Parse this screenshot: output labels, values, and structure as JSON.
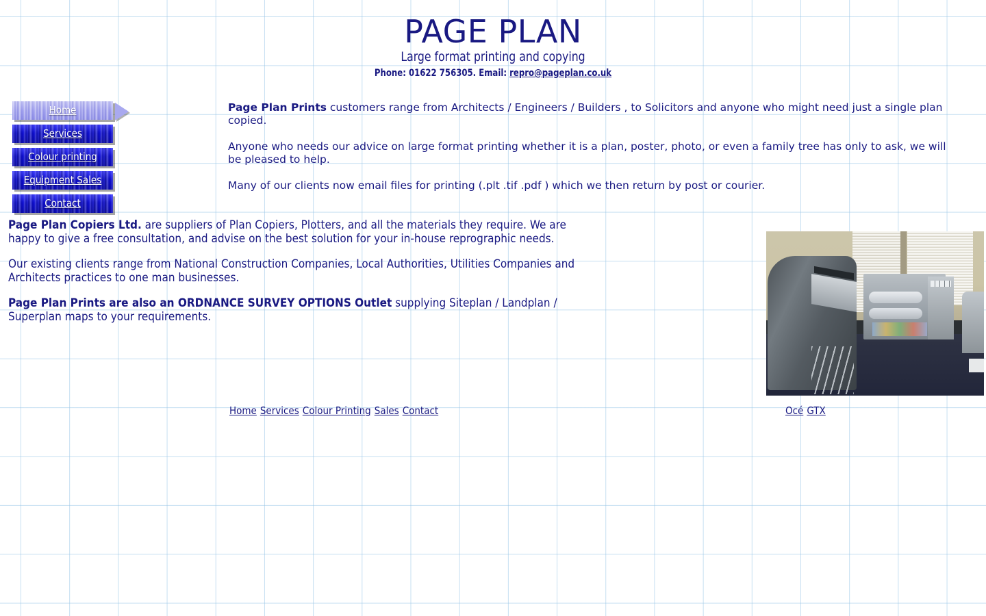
{
  "header": {
    "title": "PAGE PLAN",
    "tagline": "Large format printing and copying",
    "phone_label": "Phone: 01622 756305. Email:",
    "email": "repro@pageplan.co.uk"
  },
  "nav": {
    "items": [
      {
        "label": "Home",
        "active": true
      },
      {
        "label": "Services",
        "active": false
      },
      {
        "label": "Colour printing",
        "active": false
      },
      {
        "label": "Equipment Sales",
        "active": false
      },
      {
        "label": "Contact",
        "active": false
      }
    ]
  },
  "intro": {
    "p1_bold": "Page Plan Prints",
    "p1_rest": " customers range from Architects / Engineers / Builders , to Solicitors and anyone who might need just a single plan copied.",
    "p2": "Anyone who needs our advice on large format printing whether it is a plan, poster, photo, or even a family tree has only to ask, we will be pleased to help.",
    "p3": "Many of our clients now email files for printing (.plt .tif .pdf ) which we then return by post or courier."
  },
  "copiers": {
    "p1_bold": "Page Plan Copiers Ltd.",
    "p1_rest": " are suppliers of Plan Copiers, Plotters, and all the materials they require. We are happy to give a free consultation, and advise on the best solution for your in-house reprographic needs.",
    "p2": "Our existing clients range from National Construction Companies, Local Authorities, Utilities Companies and Architects practices to one man businesses.",
    "p3_bold": "Page Plan Prints are also an ORDNANCE SURVEY OPTIONS Outlet",
    "p3_rest": " supplying Siteplan / Landplan / Superplan maps to your requirements."
  },
  "photo": {
    "alt": "Reprographics room with large format plan copier and plotter"
  },
  "footer": {
    "links": [
      "Home",
      "Services",
      "Colour Printing",
      "Sales",
      "Contact"
    ],
    "brand_links": [
      "Océ",
      "GTX"
    ]
  },
  "colors": {
    "text_navy": "#191982",
    "grid_line": "#96c4e6",
    "button_blue": "#1414e6",
    "button_active": "#a3a3ef"
  }
}
